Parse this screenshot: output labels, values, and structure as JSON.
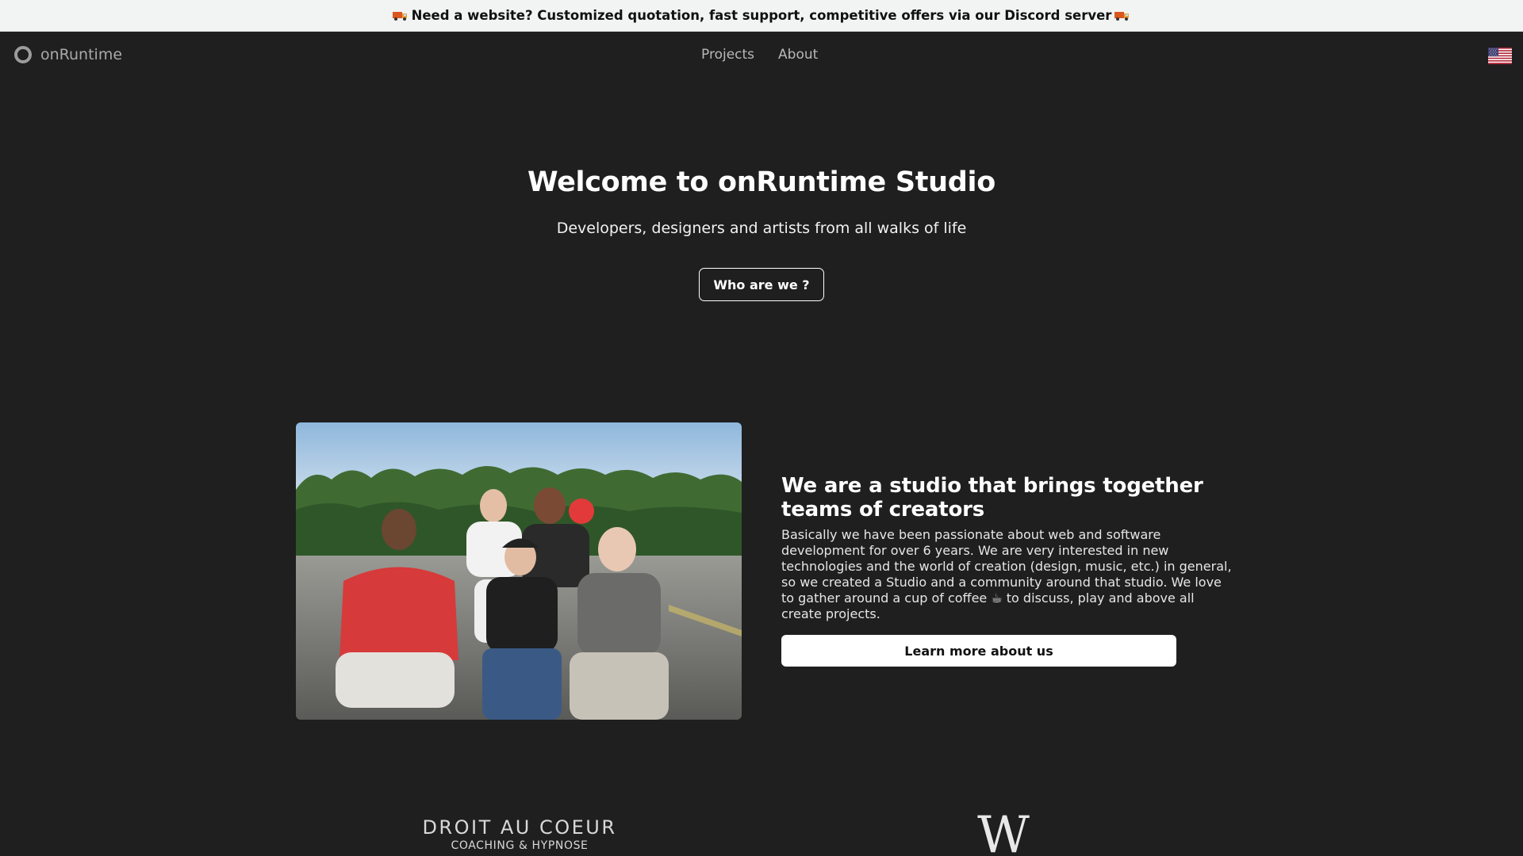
{
  "banner": {
    "text": "Need a website? Customized quotation, fast support, competitive offers via our Discord server",
    "icon": "truck-emoji"
  },
  "nav": {
    "logo_text": "onRuntime",
    "links": [
      "Projects",
      "About"
    ],
    "language_icon": "us-flag-icon"
  },
  "hero": {
    "title": "Welcome to onRuntime Studio",
    "subtitle": "Developers, designers and artists from all walks of life",
    "button_label": "Who are we ?"
  },
  "about": {
    "title": "We are a studio that brings together teams of creators",
    "text_lines": [
      "Basically we have been passionate about web and software",
      "development for over 6 years. We are very interested in new",
      "technologies and the world of creation (design, music, etc.) in general,",
      "so we created a Studio and a community around that studio. We love",
      "to gather around a cup of coffee ☕ to discuss, play and above all",
      "create projects."
    ],
    "button_label": "Learn more about us"
  },
  "clients": {
    "client1_name": "DROIT AU COEUR",
    "client1_tagline": "COACHING & HYPNOSE",
    "client2_mark": "W"
  },
  "colors": {
    "background": "#1f1f1f",
    "banner_bg": "#f2f3f3",
    "text": "#ffffff",
    "muted": "#b8b8b8"
  }
}
